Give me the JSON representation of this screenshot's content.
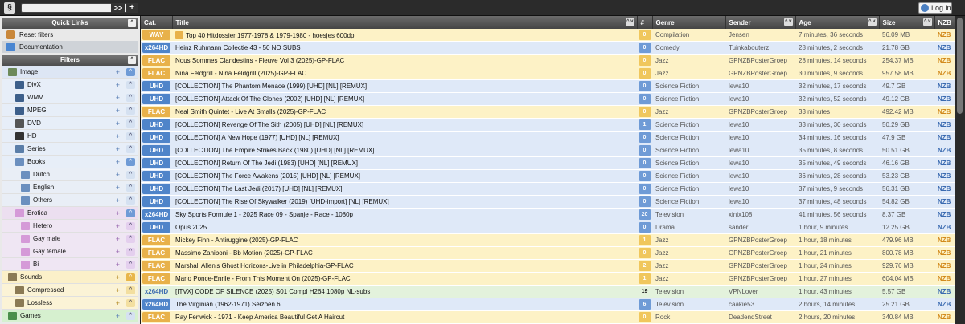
{
  "topbar": {
    "logo": "§",
    "search_btn": ">>",
    "plus_btn": "+",
    "login_label": "Log in"
  },
  "sidebar": {
    "quick_links_title": "Quick Links",
    "quick_links": [
      {
        "label": "Reset filters",
        "icon": "home-icon",
        "active": false
      },
      {
        "label": "Documentation",
        "icon": "help-icon",
        "active": true
      }
    ],
    "filters_title": "Filters",
    "filters": [
      {
        "label": "Image",
        "level": "l0",
        "icon": "image-icon",
        "tog": "^",
        "on": true
      },
      {
        "label": "DivX",
        "level": "l1",
        "icon": "film-icon",
        "tog": "^",
        "on": false
      },
      {
        "label": "WMV",
        "level": "l1",
        "icon": "film-icon",
        "tog": "^",
        "on": false
      },
      {
        "label": "MPEG",
        "level": "l1",
        "icon": "film-icon",
        "tog": "^",
        "on": false
      },
      {
        "label": "DVD",
        "level": "l1",
        "icon": "dvd-icon",
        "tog": "^",
        "on": false
      },
      {
        "label": "HD",
        "level": "l1",
        "icon": "hd-icon",
        "tog": "^",
        "on": false
      },
      {
        "label": "Series",
        "level": "l1",
        "icon": "tv-icon",
        "tog": "^",
        "on": false
      },
      {
        "label": "Books",
        "level": "l1",
        "icon": "book-icon",
        "tog": "^",
        "on": true
      },
      {
        "label": "Dutch",
        "level": "l2",
        "icon": "book-icon",
        "tog": "^",
        "on": false
      },
      {
        "label": "English",
        "level": "l2",
        "icon": "book-icon",
        "tog": "^",
        "on": false
      },
      {
        "label": "Others",
        "level": "l2",
        "icon": "book-icon",
        "tog": "^",
        "on": false
      },
      {
        "label": "Erotica",
        "level": "er0",
        "icon": "erotica-icon",
        "tog": "^",
        "on": true
      },
      {
        "label": "Hetero",
        "level": "er1",
        "icon": "erotica-icon",
        "tog": "^",
        "on": false
      },
      {
        "label": "Gay male",
        "level": "er1",
        "icon": "erotica-icon",
        "tog": "^",
        "on": false
      },
      {
        "label": "Gay female",
        "level": "er1",
        "icon": "erotica-icon",
        "tog": "^",
        "on": false
      },
      {
        "label": "Bi",
        "level": "er1",
        "icon": "erotica-icon",
        "tog": "^",
        "on": false
      },
      {
        "label": "Sounds",
        "level": "snd0",
        "icon": "music-icon",
        "tog": "^",
        "on": true
      },
      {
        "label": "Compressed",
        "level": "snd1",
        "icon": "music-icon",
        "tog": "^",
        "on": false
      },
      {
        "label": "Lossless",
        "level": "snd1",
        "icon": "music-icon",
        "tog": "^",
        "on": false
      },
      {
        "label": "Games",
        "level": "gm0",
        "icon": "game-icon",
        "tog": "^",
        "on": false
      }
    ]
  },
  "table": {
    "headers": {
      "cat": "Cat.",
      "title": "Title",
      "count": "#",
      "genre": "Genre",
      "sender": "Sender",
      "age": "Age",
      "size": "Size",
      "nzb": "NZB"
    },
    "rows": [
      {
        "kind": "audio",
        "cat": "WAV",
        "play": true,
        "title": "Top 40 Hitdossier 1977-1978 & 1979-1980 - hoesjes 600dpi",
        "count": "0",
        "genre": "Compilation",
        "sender": "Jensen",
        "age": "7 minutes, 36 seconds",
        "size": "56.09 MB",
        "nzb": "NZB"
      },
      {
        "kind": "video",
        "cat": "x264HD",
        "title": "Heinz Ruhmann Collectie 43 - 50 NO SUBS",
        "count": "0",
        "genre": "Comedy",
        "sender": "Tuinkabouterz",
        "age": "28 minutes, 2 seconds",
        "size": "21.78 GB",
        "nzb": "NZB"
      },
      {
        "kind": "audio",
        "cat": "FLAC",
        "title": "Nous Sommes Clandestins - Fleuve Vol 3 (2025)-GP-FLAC",
        "count": "0",
        "genre": "Jazz",
        "sender": "GPNZBPosterGroep",
        "age": "28 minutes, 14 seconds",
        "size": "254.37 MB",
        "nzb": "NZB"
      },
      {
        "kind": "audio",
        "cat": "FLAC",
        "title": "Nina Feldgrill - Nina Feldgrill (2025)-GP-FLAC",
        "count": "0",
        "genre": "Jazz",
        "sender": "GPNZBPosterGroep",
        "age": "30 minutes, 9 seconds",
        "size": "957.58 MB",
        "nzb": "NZB"
      },
      {
        "kind": "video",
        "cat": "UHD",
        "title": "[COLLECTION] The Phantom Menace (1999) [UHD] [NL] [REMUX]",
        "count": "0",
        "genre": "Science Fiction",
        "sender": "lewa10",
        "age": "32 minutes, 17 seconds",
        "size": "49.7 GB",
        "nzb": "NZB"
      },
      {
        "kind": "video",
        "cat": "UHD",
        "title": "[COLLECTION] Attack Of The Clones (2002) [UHD] [NL] [REMUX]",
        "count": "0",
        "genre": "Science Fiction",
        "sender": "lewa10",
        "age": "32 minutes, 52 seconds",
        "size": "49.12 GB",
        "nzb": "NZB"
      },
      {
        "kind": "audio",
        "cat": "FLAC",
        "title": "Neal Smith Quintet - Live At Smalls (2025)-GP-FLAC",
        "count": "0",
        "genre": "Jazz",
        "sender": "GPNZBPosterGroep",
        "age": "33 minutes",
        "size": "492.42 MB",
        "nzb": "NZB"
      },
      {
        "kind": "video",
        "cat": "UHD",
        "title": "[COLLECTION] Revenge Of The Sith (2005) [UHD] [NL] [REMUX]",
        "count": "1",
        "genre": "Science Fiction",
        "sender": "lewa10",
        "age": "33 minutes, 30 seconds",
        "size": "50.29 GB",
        "nzb": "NZB"
      },
      {
        "kind": "video",
        "cat": "UHD",
        "title": "[COLLECTION] A New Hope (1977) [UHD] [NL] [REMUX]",
        "count": "0",
        "genre": "Science Fiction",
        "sender": "lewa10",
        "age": "34 minutes, 16 seconds",
        "size": "47.9 GB",
        "nzb": "NZB"
      },
      {
        "kind": "video",
        "cat": "UHD",
        "title": "[COLLECTION] The Empire Strikes Back (1980) [UHD] [NL] [REMUX]",
        "count": "0",
        "genre": "Science Fiction",
        "sender": "lewa10",
        "age": "35 minutes, 8 seconds",
        "size": "50.51 GB",
        "nzb": "NZB"
      },
      {
        "kind": "video",
        "cat": "UHD",
        "title": "[COLLECTION] Return Of The Jedi (1983) [UHD] [NL] [REMUX]",
        "count": "0",
        "genre": "Science Fiction",
        "sender": "lewa10",
        "age": "35 minutes, 49 seconds",
        "size": "46.16 GB",
        "nzb": "NZB"
      },
      {
        "kind": "video",
        "cat": "UHD",
        "title": "[COLLECTION] The Force Awakens (2015) [UHD] [NL] [REMUX]",
        "count": "0",
        "genre": "Science Fiction",
        "sender": "lewa10",
        "age": "36 minutes, 28 seconds",
        "size": "53.23 GB",
        "nzb": "NZB"
      },
      {
        "kind": "video",
        "cat": "UHD",
        "title": "[COLLECTION] The Last Jedi (2017) [UHD] [NL] [REMUX]",
        "count": "0",
        "genre": "Science Fiction",
        "sender": "lewa10",
        "age": "37 minutes, 9 seconds",
        "size": "56.31 GB",
        "nzb": "NZB"
      },
      {
        "kind": "video",
        "cat": "UHD",
        "title": "[COLLECTION] The Rise Of Skywalker (2019) [UHD-import] [NL] [REMUX]",
        "count": "0",
        "genre": "Science Fiction",
        "sender": "lewa10",
        "age": "37 minutes, 48 seconds",
        "size": "54.82 GB",
        "nzb": "NZB"
      },
      {
        "kind": "tvlabel",
        "cat": "x264HD",
        "title": "Sky Sports Formule 1 - 2025 Race 09 - Spanje - Race - 1080p",
        "count": "20",
        "genre": "Television",
        "sender": "xinix108",
        "age": "41 minutes, 56 seconds",
        "size": "8.37 GB",
        "nzb": "NZB"
      },
      {
        "kind": "video",
        "cat": "UHD",
        "title": "Opus 2025",
        "count": "0",
        "genre": "Drama",
        "sender": "sander",
        "age": "1 hour, 9 minutes",
        "size": "12.25 GB",
        "nzb": "NZB"
      },
      {
        "kind": "audio",
        "cat": "FLAC",
        "title": "Mickey Finn - Antiruggine (2025)-GP-FLAC",
        "count": "1",
        "genre": "Jazz",
        "sender": "GPNZBPosterGroep",
        "age": "1 hour, 18 minutes",
        "size": "479.96 MB",
        "nzb": "NZB"
      },
      {
        "kind": "audio",
        "cat": "FLAC",
        "title": "Massimo Zaniboni - Bb Motion (2025)-GP-FLAC",
        "count": "0",
        "genre": "Jazz",
        "sender": "GPNZBPosterGroep",
        "age": "1 hour, 21 minutes",
        "size": "800.78 MB",
        "nzb": "NZB"
      },
      {
        "kind": "audio",
        "cat": "FLAC",
        "title": "Marshall Allen's Ghost Horizons-Live in Philadelphia-GP-FLAC",
        "count": "2",
        "genre": "Jazz",
        "sender": "GPNZBPosterGroep",
        "age": "1 hour, 24 minutes",
        "size": "929.76 MB",
        "nzb": "NZB"
      },
      {
        "kind": "audio",
        "cat": "FLAC",
        "title": "Mario Ponce-Enrile - From This Moment On (2025)-GP-FLAC",
        "count": "1",
        "genre": "Jazz",
        "sender": "GPNZBPosterGroep",
        "age": "1 hour, 27 minutes",
        "size": "604.04 MB",
        "nzb": "NZB"
      },
      {
        "kind": "tv",
        "cat": "x264HD",
        "title": "[ITVX] CODE OF SILENCE (2025) S01 Compl H264 1080p NL-subs",
        "count": "19",
        "genre": "Television",
        "sender": "VPNLover",
        "age": "1 hour, 43 minutes",
        "size": "5.57 GB",
        "nzb": "NZB"
      },
      {
        "kind": "video",
        "cat": "x264HD",
        "title": "The Virginian (1962-1971) Seizoen 6",
        "count": "6",
        "genre": "Television",
        "sender": "caakie53",
        "age": "2 hours, 14 minutes",
        "size": "25.21 GB",
        "nzb": "NZB"
      },
      {
        "kind": "audio",
        "cat": "FLAC",
        "title": "Ray Fenwick - 1971 - Keep America Beautiful Get A Haircut",
        "count": "0",
        "genre": "Rock",
        "sender": "DeadendStreet",
        "age": "2 hours, 20 minutes",
        "size": "340.84 MB",
        "nzb": "NZB"
      }
    ]
  },
  "colors": {
    "audio": "#e8b14a",
    "video": "#4f84c9",
    "tv_bg": "#e3f2dc",
    "nzb_audio": "#d28a1c",
    "nzb_video": "#3a6ab0"
  }
}
